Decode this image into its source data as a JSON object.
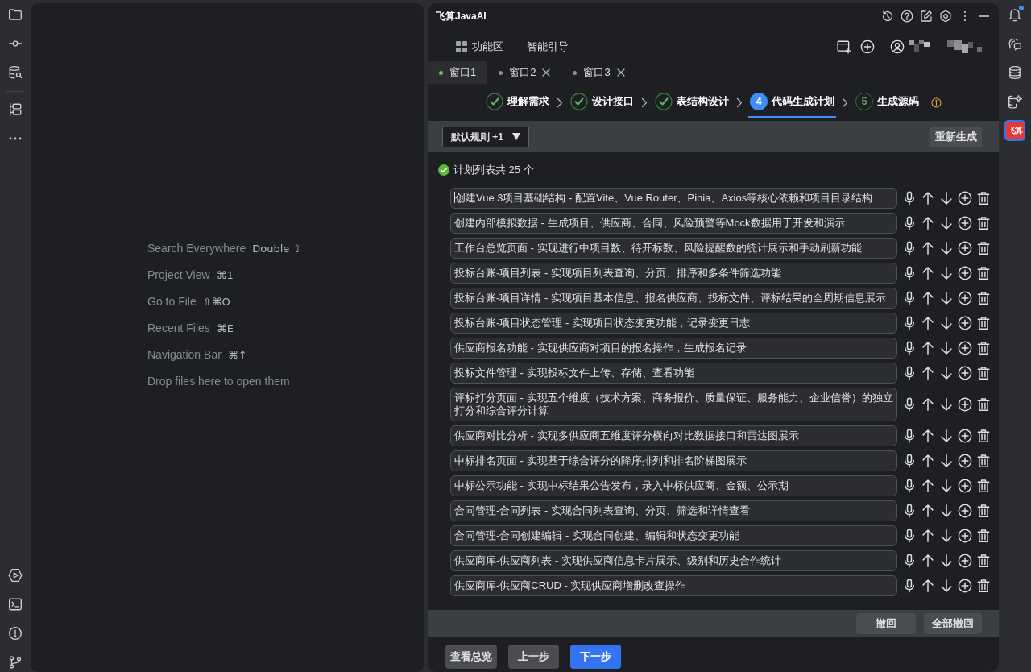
{
  "editor_hints": [
    {
      "label": "Search Everywhere",
      "shortcut": "Double ⇧"
    },
    {
      "label": "Project View",
      "shortcut": "⌘1"
    },
    {
      "label": "Go to File",
      "shortcut": "⇧⌘O"
    },
    {
      "label": "Recent Files",
      "shortcut": "⌘E"
    },
    {
      "label": "Navigation Bar",
      "shortcut": "⌘↑"
    },
    {
      "label": "Drop files here to open them"
    }
  ],
  "ai_panel": {
    "title": "飞算JavaAI",
    "function_area": "功能区",
    "guide": "智能引导",
    "tabs": [
      {
        "label": "窗口1",
        "selected": true
      },
      {
        "label": "窗口2",
        "selected": false
      },
      {
        "label": "窗口3",
        "selected": false
      }
    ],
    "steps": [
      {
        "label": "理解需求",
        "completed": true,
        "selected": false
      },
      {
        "label": "设计接口",
        "completed": true,
        "selected": false
      },
      {
        "label": "表结构设计",
        "completed": true,
        "selected": false
      },
      {
        "number": "4",
        "label": "代码生成计划",
        "completed": false,
        "selected": true
      },
      {
        "number": "5",
        "label": "生成源码",
        "completed": false,
        "selected": false
      }
    ],
    "rules_dropdown": {
      "value": "默认规则 +1"
    },
    "regenerate_button": "重新生成",
    "plan_summary": "计划列表共 25 个",
    "plan_items": [
      {
        "text": "创建Vue 3项目基础结构 - 配置Vite、Vue Router、Pinia、Axios等核心依赖和项目目录结构",
        "focused": true
      },
      {
        "text": "创建内部模拟数据 - 生成项目、供应商、合同、风险预警等Mock数据用于开发和演示",
        "focused": false
      },
      {
        "text": "工作台总览页面 - 实现进行中项目数、待开标数、风险提醒数的统计展示和手动刷新功能",
        "focused": false
      },
      {
        "text": "投标台账-项目列表 - 实现项目列表查询、分页、排序和多条件筛选功能",
        "focused": false
      },
      {
        "text": "投标台账-项目详情 - 实现项目基本信息、报名供应商、投标文件、评标结果的全周期信息展示",
        "focused": false
      },
      {
        "text": "投标台账-项目状态管理 - 实现项目状态变更功能，记录变更日志",
        "focused": false
      },
      {
        "text": "供应商报名功能 - 实现供应商对项目的报名操作，生成报名记录",
        "focused": false
      },
      {
        "text": "投标文件管理 - 实现投标文件上传、存储、查看功能",
        "focused": false
      },
      {
        "text": "评标打分页面 - 实现五个维度（技术方案、商务报价、质量保证、服务能力、企业信誉）的独立打分和综合评分计算",
        "focused": false
      },
      {
        "text": "供应商对比分析 - 实现多供应商五维度评分横向对比数据接口和雷达图展示",
        "focused": false
      },
      {
        "text": "中标排名页面 - 实现基于综合评分的降序排列和排名阶梯图展示",
        "focused": false
      },
      {
        "text": "中标公示功能 - 实现中标结果公告发布，录入中标供应商、金额、公示期",
        "focused": false
      },
      {
        "text": "合同管理-合同列表 - 实现合同列表查询、分页、筛选和详情查看",
        "focused": false
      },
      {
        "text": "合同管理-合同创建编辑 - 实现合同创建、编辑和状态变更功能",
        "focused": false
      },
      {
        "text": "供应商库-供应商列表 - 实现供应商信息卡片展示、级别和历史合作统计",
        "focused": false
      },
      {
        "text": "供应商库-供应商CRUD - 实现供应商增删改查操作",
        "focused": false
      }
    ],
    "undo_button": "撤回",
    "undo_all_button": "全部撤回",
    "footer_buttons": [
      {
        "label": "查看总览",
        "kind": "secondary"
      },
      {
        "label": "上一步",
        "kind": "secondary"
      },
      {
        "label": "下一步",
        "kind": "primary"
      }
    ]
  },
  "right_toolbar": {
    "has_notification": true,
    "plugin_logo": "飞算"
  }
}
